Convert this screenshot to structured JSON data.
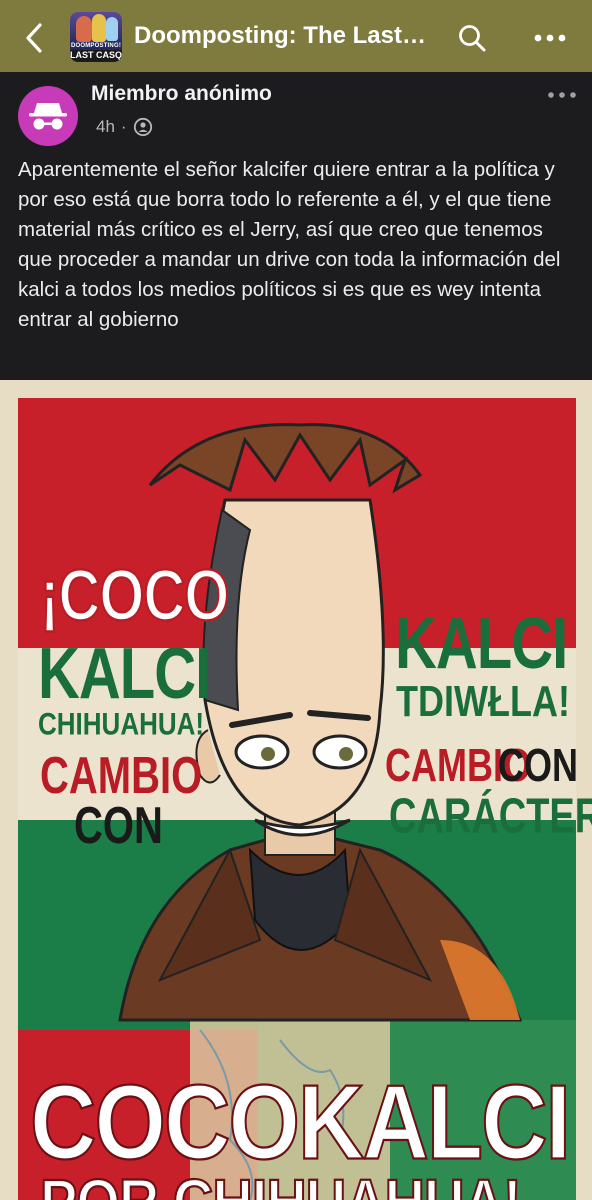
{
  "header": {
    "group_title": "Doomposting: The Last…",
    "group_thumb_line1": "DOOMPOSTING!",
    "group_thumb_line2": "LAST CASQ",
    "icons": {
      "back": "chevron-left-icon",
      "search": "search-icon",
      "menu": "more-horizontal-icon"
    }
  },
  "post": {
    "author": "Miembro anónimo",
    "time": "4h",
    "separator": "·",
    "privacy_icon": "group-privacy-icon",
    "avatar_icon": "incognito-icon",
    "avatar_color": "#c73bb8",
    "text": "Aparentemente el señor kalcifer quiere entrar a la política y por eso está que borra todo lo referente a él, y el que tiene material más crítico es el Jerry, así que creo que tenemos que proceder a mandar un drive con toda la información del kalci a todos los medios políticos si es que es wey intenta entrar al gobierno"
  },
  "poster": {
    "left_line1": "¡COCO",
    "left_line2": "KALCI",
    "left_line3": "CHIHUAHUA!",
    "left_line4": "CAMBIO",
    "left_line5": "CON",
    "right_line1": "KALCI",
    "right_line2": "TDIWŁLA!",
    "right_line3a": "CAMBIO",
    "right_line3b": "CON",
    "right_line4": "CARÁCTER",
    "bottom_line1": "COCOKALCI",
    "bottom_line2": "POR CHIHUAHUA!"
  },
  "colors": {
    "topbar": "#7f7a3d",
    "background": "#1c1c1e",
    "flag_red": "#c8202b",
    "flag_green": "#1b7d48"
  }
}
